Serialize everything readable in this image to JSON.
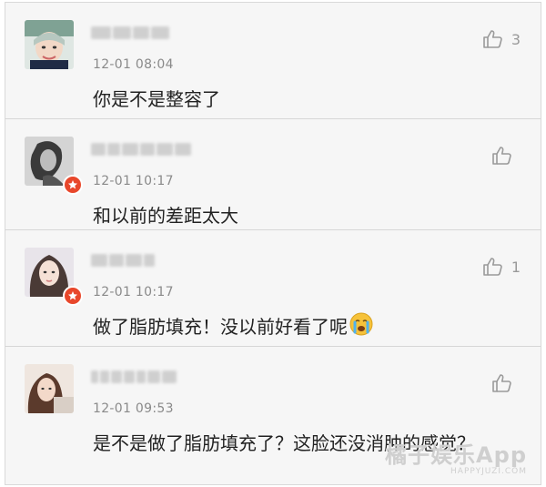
{
  "comments": [
    {
      "username_masked": "",
      "time": "12-01 08:04",
      "text": "你是不是整容了",
      "likes": "3",
      "verified": false,
      "avatar": "avatar-1"
    },
    {
      "username_masked": "",
      "time": "12-01 10:17",
      "text": "和以前的差距太大",
      "likes": "",
      "verified": true,
      "avatar": "avatar-2"
    },
    {
      "username_masked": "",
      "time": "12-01 10:17",
      "text": "做了脂肪填充！没以前好看了呢",
      "likes": "1",
      "verified": true,
      "avatar": "avatar-3",
      "emoji": "crying-face-icon"
    },
    {
      "username_masked": "",
      "time": "12-01 09:53",
      "text": "是不是做了脂肪填充了？这脸还没消肿的感觉？",
      "likes": "",
      "verified": false,
      "avatar": "avatar-4"
    }
  ],
  "watermark": {
    "main": "橘子娱乐App",
    "sub": "HAPPYJUZI.COM"
  },
  "icons": {
    "like": "thumbs-up-icon",
    "verified": "verified-star-badge-icon"
  },
  "colors": {
    "background": "#f6f6f6",
    "badge": "#e8472b",
    "time_text": "#8a8a8a",
    "like_icon": "#9a9a9a"
  }
}
